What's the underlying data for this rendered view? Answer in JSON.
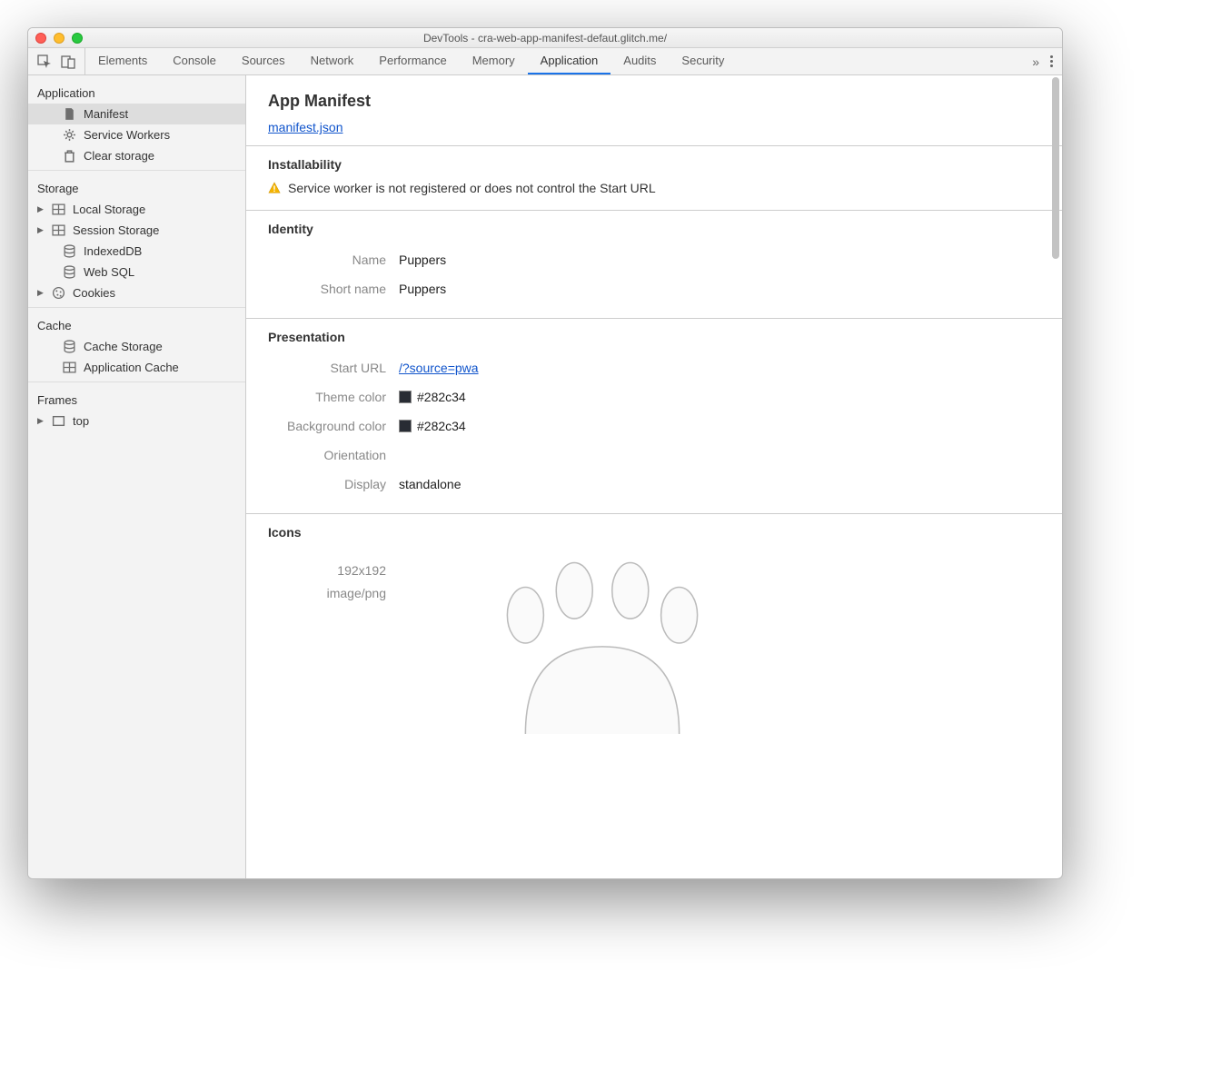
{
  "window": {
    "title": "DevTools - cra-web-app-manifest-defaut.glitch.me/"
  },
  "tabs": {
    "items": [
      "Elements",
      "Console",
      "Sources",
      "Network",
      "Performance",
      "Memory",
      "Application",
      "Audits",
      "Security"
    ],
    "active": "Application"
  },
  "sidebar": {
    "application": {
      "header": "Application",
      "items": [
        {
          "label": "Manifest",
          "selected": true
        },
        {
          "label": "Service Workers"
        },
        {
          "label": "Clear storage"
        }
      ]
    },
    "storage": {
      "header": "Storage",
      "items": [
        {
          "label": "Local Storage",
          "expandable": true
        },
        {
          "label": "Session Storage",
          "expandable": true
        },
        {
          "label": "IndexedDB"
        },
        {
          "label": "Web SQL"
        },
        {
          "label": "Cookies",
          "expandable": true
        }
      ]
    },
    "cache": {
      "header": "Cache",
      "items": [
        {
          "label": "Cache Storage"
        },
        {
          "label": "Application Cache"
        }
      ]
    },
    "frames": {
      "header": "Frames",
      "items": [
        {
          "label": "top",
          "expandable": true
        }
      ]
    }
  },
  "main": {
    "title": "App Manifest",
    "manifest_link": "manifest.json",
    "installability": {
      "header": "Installability",
      "warning": "Service worker is not registered or does not control the Start URL"
    },
    "identity": {
      "header": "Identity",
      "name_label": "Name",
      "name_value": "Puppers",
      "short_name_label": "Short name",
      "short_name_value": "Puppers"
    },
    "presentation": {
      "header": "Presentation",
      "start_url_label": "Start URL",
      "start_url_value": "/?source=pwa",
      "theme_label": "Theme color",
      "theme_value": "#282c34",
      "bg_label": "Background color",
      "bg_value": "#282c34",
      "orientation_label": "Orientation",
      "orientation_value": "",
      "display_label": "Display",
      "display_value": "standalone"
    },
    "icons": {
      "header": "Icons",
      "size": "192x192",
      "mime": "image/png"
    }
  },
  "colors": {
    "theme_swatch": "#282c34",
    "bg_swatch": "#282c34"
  }
}
